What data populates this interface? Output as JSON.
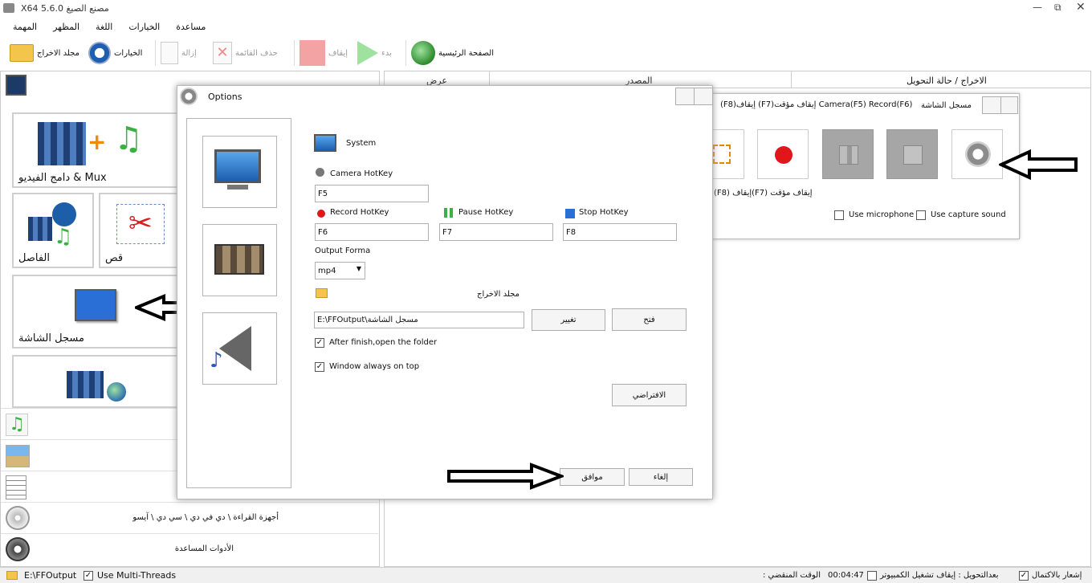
{
  "titlebar": {
    "title": "X64 5.6.0 مصنع الصيغ"
  },
  "menu": [
    "المهمة",
    "المظهر",
    "اللغة",
    "الخيارات",
    "مساعدة"
  ],
  "toolbar": {
    "output_folder": "مجلد الاخراج",
    "options": "الخيارات",
    "remove": "إزالة",
    "clear_list": "حذف القائمة",
    "stop": "إيقاف",
    "start": "بدء",
    "home": "الصفحة الرئيسية"
  },
  "task_table": {
    "headers": [
      "عرض",
      "المصدر",
      "الاخراج / حالة التحويل"
    ]
  },
  "left_panel": {
    "tiles": {
      "mux": "دامج الفيديو & Mux",
      "joiner": "الفاصل",
      "crop": "قص",
      "screen_recorder": "مسجل الشاشة"
    },
    "categories": {
      "rom": "أجهزة القراءة \\ دي في دي \\ سي دي \\ آيسو",
      "utilities": "الأدوات المساعدة"
    }
  },
  "options_dialog": {
    "title": "Options",
    "system_label": "System",
    "camera_hotkey_label": "Camera HotKey",
    "camera_hotkey_value": "F5",
    "record_hotkey_label": "Record HotKey",
    "record_hotkey_value": "F6",
    "pause_hotkey_label": "Pause HotKey",
    "pause_hotkey_value": "F7",
    "stop_hotkey_label": "Stop HotKey",
    "stop_hotkey_value": "F8",
    "output_format_label": "Output Forma",
    "output_format_value": "mp4",
    "output_folder_label": "مجلد الاخراج",
    "output_folder_value": "E:\\FFOutput\\مسجل الشاشة",
    "change_button": "تغيير",
    "open_button": "فتح",
    "after_finish_label": "After finish,open the folder",
    "after_finish_checked": "✓",
    "always_on_top_label": "Window always on top",
    "always_on_top_checked": "✓",
    "default_button": "الافتراضي",
    "ok_button": "موافق",
    "cancel_button": "إلغاء"
  },
  "recorder_window": {
    "title": "مسجل الشاشة",
    "hotkeys_line": "Camera(F5) Record(F6) إيقاف مؤقت(F7) إيقاف(F8)",
    "hotkeys_line2": "إيقاف مؤقت (F7)إيقاف (F8)",
    "use_microphone": "Use microphone",
    "use_capture_sound": "Use capture sound"
  },
  "statusbar": {
    "output_path": "E:\\FFOutput",
    "multi_threads": "Use Multi-Threads",
    "multi_threads_checked": "✓",
    "elapsed_label": "الوقت المنقضي :",
    "elapsed_value": "00:04:47",
    "shutdown_label": "بعدالتحويل : إيقاف تشغيل الكمبيوتر",
    "notify_label": "إشعار بالاكتمال",
    "notify_checked": "✓"
  },
  "colors": {
    "accent": "#0a64c8",
    "record_red": "#e0161b",
    "pause_green": "#3cb043",
    "stop_blue": "#2a6fd6"
  }
}
